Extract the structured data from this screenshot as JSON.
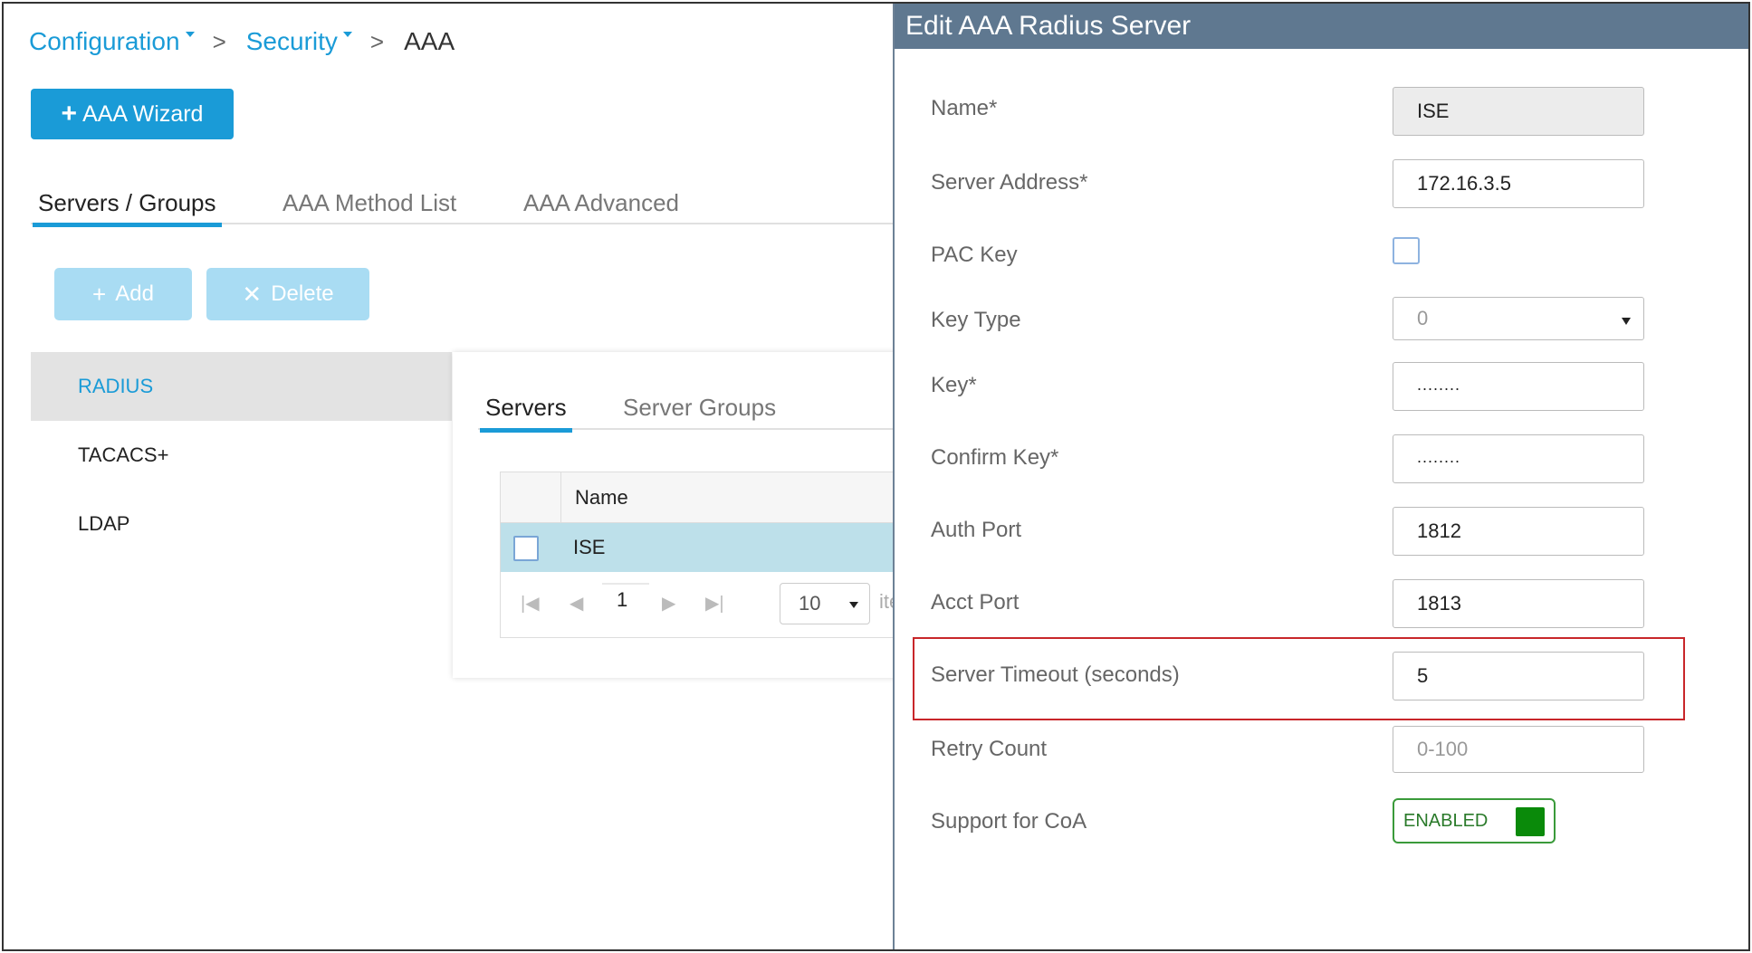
{
  "breadcrumb": {
    "items": [
      {
        "label": "Configuration"
      },
      {
        "label": "Security"
      },
      {
        "label": "AAA"
      }
    ]
  },
  "wizard_button": {
    "label": "AAA Wizard"
  },
  "tabs": [
    {
      "label": "Servers / Groups",
      "active": true
    },
    {
      "label": "AAA Method List",
      "active": false
    },
    {
      "label": "AAA Advanced",
      "active": false
    }
  ],
  "actions": {
    "add_label": "Add",
    "delete_label": "Delete"
  },
  "sidebar": {
    "items": [
      {
        "label": "RADIUS",
        "active": true
      },
      {
        "label": "TACACS+",
        "active": false
      },
      {
        "label": "LDAP",
        "active": false
      }
    ]
  },
  "inner_tabs": [
    {
      "label": "Servers",
      "active": true
    },
    {
      "label": "Server Groups",
      "active": false
    }
  ],
  "grid": {
    "columns": [
      "Name"
    ],
    "rows": [
      {
        "name": "ISE",
        "checked": false
      }
    ]
  },
  "pager": {
    "page": "1",
    "page_size": "10",
    "items_text": "ite"
  },
  "edit_panel": {
    "title": "Edit AAA Radius Server",
    "fields": {
      "name": {
        "label": "Name*",
        "value": "ISE"
      },
      "server_address": {
        "label": "Server Address*",
        "value": "172.16.3.5"
      },
      "pac_key": {
        "label": "PAC Key",
        "checked": false
      },
      "key_type": {
        "label": "Key Type",
        "value": "0"
      },
      "key": {
        "label": "Key*",
        "value": "........"
      },
      "confirm_key": {
        "label": "Confirm Key*",
        "value": "........"
      },
      "auth_port": {
        "label": "Auth Port",
        "value": "1812"
      },
      "acct_port": {
        "label": "Acct Port",
        "value": "1813"
      },
      "server_timeout": {
        "label": "Server Timeout (seconds)",
        "value": "5"
      },
      "retry_count": {
        "label": "Retry Count",
        "placeholder": "0-100"
      },
      "support_coa": {
        "label": "Support for CoA",
        "value": "ENABLED"
      }
    }
  },
  "colors": {
    "accent": "#1a9bd7",
    "header": "#5f7890",
    "highlight": "#c8262a",
    "enabled": "#0a8a0a"
  }
}
